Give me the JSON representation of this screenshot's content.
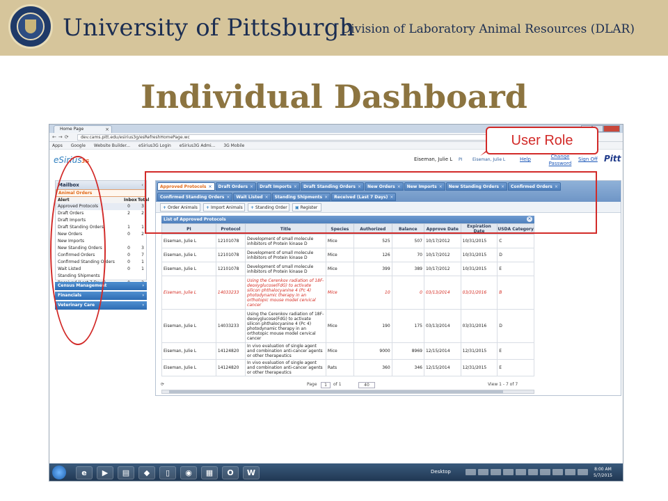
{
  "slide": {
    "university": "University of Pittsburgh",
    "division": "Division of Laboratory Animal Resources (DLAR)",
    "title": "Individual Dashboard",
    "callout": "User Role"
  },
  "browser": {
    "tab_title": "Home Page",
    "url": "dev.cams.pitt.edu/esirius3g/esRefreshHomePage.wc",
    "bookmarks": [
      "Apps",
      "Google",
      "Website Builder...",
      "eSirius3G Login",
      "eSirius3G Admi...",
      "3G Mobile"
    ]
  },
  "app": {
    "logo": "eSirius",
    "logo_suffix": "3G",
    "user_name": "Eiseman, Julie L",
    "role": "PI",
    "role_user": "Eiseman, Julie L",
    "help": "Help",
    "change_password": "Change Password",
    "sign_off": "Sign Off",
    "brand": "Pitt"
  },
  "mailbox": {
    "title": "Mailbox",
    "section": "Animal Orders",
    "col_alert": "Alert",
    "col_inbox": "Inbox",
    "col_total": "Total",
    "rows": [
      {
        "label": "Approved Protocols",
        "inbox": "0",
        "total": "3"
      },
      {
        "label": "Draft Orders",
        "inbox": "2",
        "total": "2"
      },
      {
        "label": "Draft Imports",
        "inbox": "",
        "total": ""
      },
      {
        "label": "Draft Standing Orders",
        "inbox": "1",
        "total": "1"
      },
      {
        "label": "New Orders",
        "inbox": "0",
        "total": "2"
      },
      {
        "label": "New Imports",
        "inbox": "",
        "total": ""
      },
      {
        "label": "New Standing Orders",
        "inbox": "0",
        "total": "3"
      },
      {
        "label": "Confirmed Orders",
        "inbox": "0",
        "total": "7"
      },
      {
        "label": "Confirmed Standing Orders",
        "inbox": "0",
        "total": "1"
      },
      {
        "label": "Wait Listed",
        "inbox": "0",
        "total": "1"
      },
      {
        "label": "Standing Shipments",
        "inbox": "",
        "total": ""
      },
      {
        "label": "Received (Last 7 Days)",
        "inbox": "0",
        "total": "2"
      }
    ],
    "sections": [
      "Census Management",
      "Financials",
      "Veterinary Care"
    ]
  },
  "tabs": [
    "Approved Protocols",
    "Draft Orders",
    "Draft Imports",
    "Draft Standing Orders",
    "New Orders",
    "New Imports",
    "New Standing Orders",
    "Confirmed Orders",
    "Confirmed Standing Orders",
    "Wait Listed",
    "Standing Shipments",
    "Received (Last 7 Days)"
  ],
  "toolbar": {
    "order_animals": "Order Animals",
    "import_animals": "Import Animals",
    "standing_order": "Standing Order",
    "register": "Register"
  },
  "grid": {
    "title": "List of Approved Protocols",
    "columns": [
      "PI",
      "Protocol",
      "Title",
      "Species",
      "Authorized",
      "Balance",
      "Approve Date",
      "Expiration Date",
      "USDA Category"
    ],
    "rows": [
      [
        "Eiseman, Julie L",
        "12101078",
        "Development of small molecule inhibitors of Protein kinase D",
        "Mice",
        "525",
        "507",
        "10/17/2012",
        "10/31/2015",
        "C"
      ],
      [
        "Eiseman, Julie L",
        "12101078",
        "Development of small molecule inhibitors of Protein kinase D",
        "Mice",
        "126",
        "70",
        "10/17/2012",
        "10/31/2015",
        "D"
      ],
      [
        "Eiseman, Julie L",
        "12101078",
        "Development of small molecule inhibitors of Protein kinase D",
        "Mice",
        "399",
        "389",
        "10/17/2012",
        "10/31/2015",
        "E"
      ],
      [
        "Eiseman, Julie L",
        "14033233",
        "Using the Cerenkov radiation of 18F-deoxyglucose(FdG) to activate silicon phthalocyanine 4 (Pc 4) photodynamic therapy in an orthotopic mouse model cervical cancer",
        "Mice",
        "10",
        "0",
        "03/13/2014",
        "03/31/2016",
        "B"
      ],
      [
        "Eiseman, Julie L",
        "14033233",
        "Using the Cerenkov radiation of 18F-deoxyglucose(FdG) to activate silicon phthalocyanine 4 (Pc 4) photodynamic therapy in an orthotopic mouse model cervical cancer",
        "Mice",
        "190",
        "175",
        "03/13/2014",
        "03/31/2016",
        "D"
      ],
      [
        "Eiseman, Julie L",
        "14124820",
        "In vivo evaluation of single agent and combination anti-cancer agents or other therapeutics",
        "Mice",
        "9000",
        "8969",
        "12/15/2014",
        "12/31/2015",
        "E"
      ],
      [
        "Eiseman, Julie L",
        "14124820",
        "In vivo evaluation of single agent and combination anti-cancer agents or other therapeutics",
        "Rats",
        "360",
        "346",
        "12/15/2014",
        "12/31/2015",
        "E"
      ]
    ],
    "red_row_index": 3
  },
  "pager": {
    "page_label": "Page",
    "page_value": "1",
    "of_label": "of 1",
    "rows_per_page": "40",
    "view_label": "View 1 - 7 of 7"
  },
  "taskbar": {
    "desktop": "Desktop",
    "time": "8:00 AM",
    "date": "5/7/2015"
  },
  "colors": {
    "banner": "#d6c59b",
    "title": "#8c7440",
    "annotation_red": "#d22a28",
    "tab_blue": "#4e80bd",
    "active_tab_text": "#e06a1a"
  }
}
